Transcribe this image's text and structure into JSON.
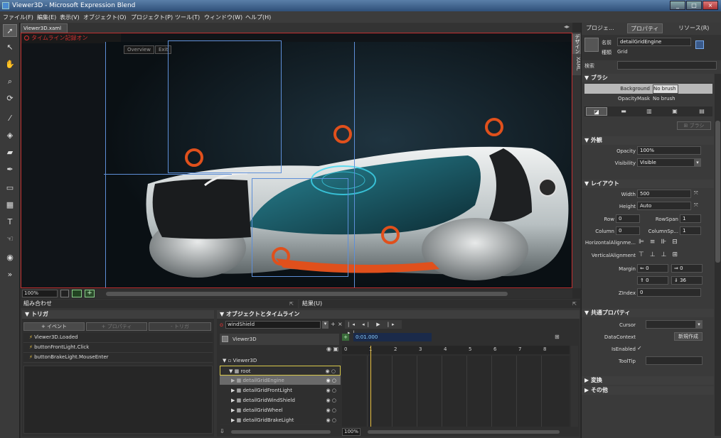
{
  "window": {
    "title": "Viewer3D - Microsoft Expression Blend"
  },
  "menu": [
    "ファイル(F)",
    "編集(E)",
    "表示(V)",
    "オブジェクト(O)",
    "プロジェクト(P)",
    "ツール(T)",
    "ウィンドウ(W)",
    "ヘルプ(H)"
  ],
  "document": {
    "tab_label": "Viewer3D.xaml",
    "close": "×"
  },
  "artboard": {
    "recording": "タイムライン記録オン",
    "nav": [
      "Overview",
      "Exit"
    ],
    "side_tabs": [
      "デザイン",
      "XAML"
    ],
    "zoom": "100%"
  },
  "interaction": {
    "title": "組み合わせ",
    "triggers_title": "トリガ",
    "buttons": [
      "+ イベント",
      "+ プロパティ",
      "- トリガ"
    ],
    "triggers": [
      "Viewer3D.Loaded",
      "buttonFrontLight.Click",
      "buttonBrakeLight.MouseEnter"
    ]
  },
  "results_tab": "結果(U)",
  "objects": {
    "title": "オブジェクトとタイムライン",
    "storyboard": "windShield",
    "scope": "Viewer3D",
    "time": "0:01.000",
    "ticks": [
      "0",
      "1",
      "2",
      "3",
      "4",
      "5",
      "6",
      "7",
      "8"
    ],
    "tree": [
      {
        "label": "Viewer3D",
        "indent": 0
      },
      {
        "label": "root",
        "indent": 1
      },
      {
        "label": "detailGridEngine",
        "indent": 2
      },
      {
        "label": "detailGridFrontLight",
        "indent": 2
      },
      {
        "label": "detailGridWindShield",
        "indent": 2
      },
      {
        "label": "detailGridWheel",
        "indent": 2
      },
      {
        "label": "detailGridBrakeLight",
        "indent": 2
      }
    ],
    "zoom": "100%"
  },
  "right_tabs": [
    "プロジェ...",
    "プロパティ",
    "リソース(R)"
  ],
  "props": {
    "name_label": "名前",
    "name_value": "detailGridEngine",
    "type_label": "種類",
    "type_value": "Grid",
    "search_label": "検索",
    "brush": {
      "title": "ブラシ",
      "rows": [
        {
          "label": "Background",
          "value": "No brush"
        },
        {
          "label": "OpacityMask",
          "value": "No brush"
        }
      ],
      "button": "ブラシ"
    },
    "appearance": {
      "title": "外観",
      "opacity_label": "Opacity",
      "opacity": "100%",
      "visibility_label": "Visibility",
      "visibility": "Visible"
    },
    "layout": {
      "title": "レイアウト",
      "width_label": "Width",
      "width": "500",
      "height_label": "Height",
      "height": "Auto",
      "row_label": "Row",
      "row": "0",
      "rowspan_label": "RowSpan",
      "rowspan": "1",
      "col_label": "Column",
      "col": "0",
      "colspan_label": "ColumnSp...",
      "colspan": "1",
      "halign_label": "HorizontalAlignme...",
      "valign_label": "VerticalAlignment",
      "margin_label": "Margin",
      "margins": [
        "0",
        "0",
        "0",
        "36"
      ],
      "zindex_label": "ZIndex",
      "zindex": "0"
    },
    "common": {
      "title": "共通プロパティ",
      "cursor_label": "Cursor",
      "datacontext_label": "DataContext",
      "new_button": "新規作成",
      "isenabled_label": "IsEnabled",
      "isenabled": "✓",
      "tooltip_label": "ToolTip"
    },
    "transform_title": "変換",
    "other_title": "その他"
  }
}
